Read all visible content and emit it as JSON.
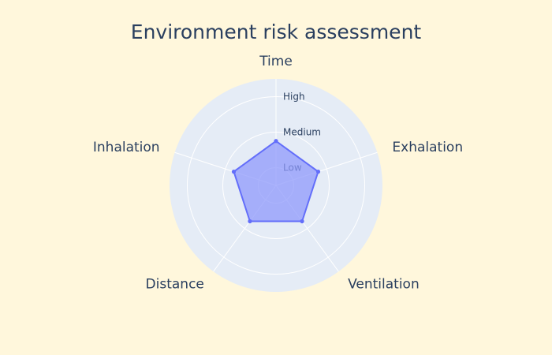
{
  "chart_data": {
    "type": "radar",
    "title": "Environment risk assessment",
    "axes": [
      "Time",
      "Exhalation",
      "Ventilation",
      "Distance",
      "Inhalation"
    ],
    "radial_levels": [
      "Low",
      "Medium",
      "High"
    ],
    "radial_range": [
      0,
      3
    ],
    "series": [
      {
        "values": [
          1.25,
          1.25,
          1.25,
          1.25,
          1.25
        ]
      }
    ],
    "grid": true,
    "legend": "none",
    "colors": {
      "background": "#fff7dc",
      "polar_bg": "#e5ecf6",
      "grid": "#ffffff",
      "fill": "#8f99fb",
      "line": "#636efa",
      "text": "#2a3f5f"
    }
  }
}
